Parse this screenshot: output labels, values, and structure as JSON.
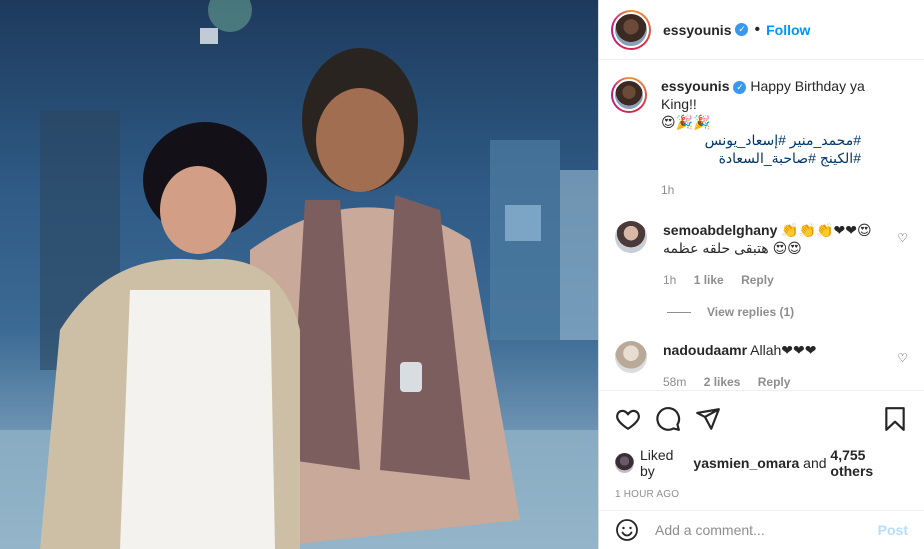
{
  "header": {
    "username": "essyounis",
    "separator": "•",
    "follow_label": "Follow"
  },
  "caption": {
    "username": "essyounis",
    "text": "Happy Birthday ya King!!",
    "emojis": "😍🎉🎉",
    "hashtags": "#محمد_منير #إسعاد_يونس #الكينج #صاحبة_السعادة",
    "time": "1h"
  },
  "comments": [
    {
      "username": "semoabdelghany",
      "emojis": "👏👏👏❤❤😍",
      "text": "😍😍 هتبقى حلقه عظمه",
      "time": "1h",
      "likes": "1 like",
      "reply": "Reply"
    },
    {
      "username": "nadoudaamr",
      "text": "Allah❤❤❤",
      "time": "58m",
      "likes": "2 likes",
      "reply": "Reply"
    }
  ],
  "view_replies": "View replies (1)",
  "likes": {
    "prefix": "Liked by",
    "user": "yasmien_omara",
    "and": "and",
    "count": "4,755 others"
  },
  "timestamp": "1 HOUR AGO",
  "add_comment": {
    "placeholder": "Add a comment...",
    "post_label": "Post"
  },
  "colors": {
    "accent": "#0095f6",
    "text": "#262626",
    "muted": "#8e8e8e",
    "hashtag": "#00376b"
  }
}
